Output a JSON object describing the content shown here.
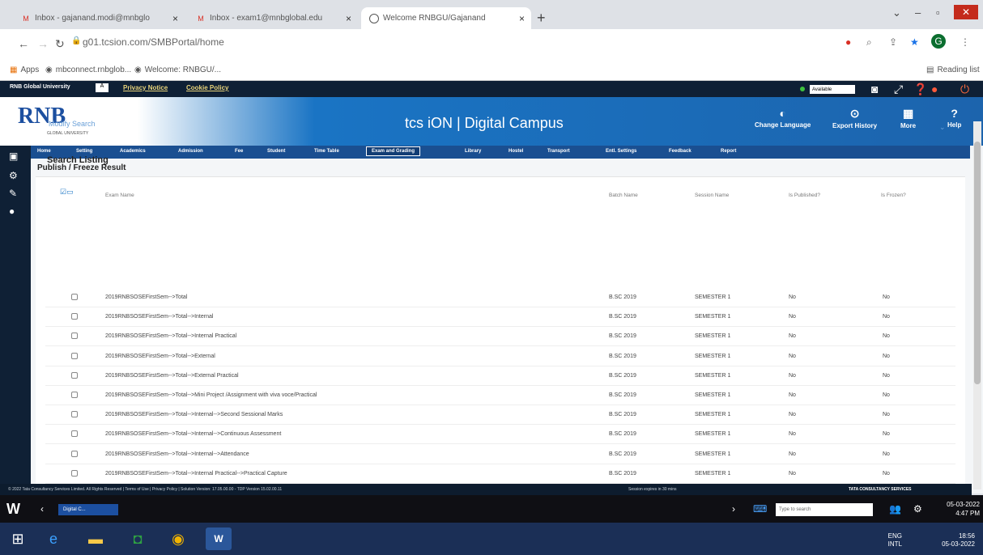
{
  "browser": {
    "tabs": [
      {
        "label": "Inbox - gajanand.modi@mnbglo",
        "close": "×"
      },
      {
        "label": "Inbox - exam1@mnbglobal.edu",
        "close": "×"
      },
      {
        "label": "Welcome RNBGU/Gajanand",
        "close": "×"
      }
    ],
    "new_tab": "+",
    "url": "g01.tcsion.com/SMBPortal/home",
    "bookmarks": [
      {
        "label": "Apps"
      },
      {
        "label": "mbconnect.rnbglob..."
      },
      {
        "label": "Welcome: RNBGU/..."
      }
    ],
    "reading_list": "Reading list",
    "profile_initial": "G"
  },
  "portal": {
    "university_label": "RNB Global University",
    "privacy": "Privacy Notice",
    "cookie": "Cookie Policy",
    "availability": "Available",
    "logo": "RNB",
    "logo_sub": "GLOBAL UNIVERSITY",
    "brand": "tcs iON | Digital Campus",
    "header_buttons": [
      "Change Language",
      "Export History",
      "More",
      "Help"
    ],
    "menu": [
      "Home",
      "Setting",
      "Academics",
      "Admission",
      "Fee",
      "Student",
      "Time Table",
      "Exam and Grading",
      "Library",
      "Hostel",
      "Transport",
      "Entl. Settings",
      "Feedback",
      "Report"
    ],
    "active_menu": "Exam and Grading",
    "breadcrumb": "Publish / Freeze Result",
    "modify_search": "Modify Search",
    "section_title": "Search Listing",
    "columns": {
      "exam": "Exam Name",
      "batch": "Batch Name",
      "session": "Session Name",
      "published": "Is Published?",
      "frozen": "Is Frozen?"
    },
    "rows": [
      {
        "exam": "2019RNBSOSEFirstSem-->Total",
        "batch": "B.SC 2019",
        "session": "SEMESTER 1",
        "published": "No",
        "frozen": "No"
      },
      {
        "exam": "2019RNBSOSEFirstSem-->Total-->Internal",
        "batch": "B.SC 2019",
        "session": "SEMESTER 1",
        "published": "No",
        "frozen": "No"
      },
      {
        "exam": "2019RNBSOSEFirstSem-->Total-->Internal Practical",
        "batch": "B.SC 2019",
        "session": "SEMESTER 1",
        "published": "No",
        "frozen": "No"
      },
      {
        "exam": "2019RNBSOSEFirstSem-->Total-->External",
        "batch": "B.SC 2019",
        "session": "SEMESTER 1",
        "published": "No",
        "frozen": "No"
      },
      {
        "exam": "2019RNBSOSEFirstSem-->Total-->External Practical",
        "batch": "B.SC 2019",
        "session": "SEMESTER 1",
        "published": "No",
        "frozen": "No"
      },
      {
        "exam": "2019RNBSOSEFirstSem-->Total-->Mini Project /Assignment with viva voce/Practical",
        "batch": "B.SC 2019",
        "session": "SEMESTER 1",
        "published": "No",
        "frozen": "No"
      },
      {
        "exam": "2019RNBSOSEFirstSem-->Total-->Internal-->Second Sessional Marks",
        "batch": "B.SC 2019",
        "session": "SEMESTER 1",
        "published": "No",
        "frozen": "No"
      },
      {
        "exam": "2019RNBSOSEFirstSem-->Total-->Internal-->Continuous Assessment",
        "batch": "B.SC 2019",
        "session": "SEMESTER 1",
        "published": "No",
        "frozen": "No"
      },
      {
        "exam": "2019RNBSOSEFirstSem-->Total-->Internal-->Attendance",
        "batch": "B.SC 2019",
        "session": "SEMESTER 1",
        "published": "No",
        "frozen": "No"
      },
      {
        "exam": "2019RNBSOSEFirstSem-->Total-->Internal Practical-->Practical Capture",
        "batch": "B.SC 2019",
        "session": "SEMESTER 1",
        "published": "No",
        "frozen": "No"
      }
    ],
    "footer_left": "© 2022 Tata Consultancy Services Limited. All Rights Reserved | Terms of Use | Privacy Policy | Solution Version: 17.05.00.00 - TDP Version 15.02.00.11",
    "footer_mid": "Session expires in 30 mins",
    "footer_right": "TATA CONSULTANCY SERVICES"
  },
  "remote_taskbar": {
    "tab": "Digital C...",
    "search": "Type to search",
    "date": "05-03-2022",
    "time": "4:47 PM"
  },
  "taskbar": {
    "lang": "ENG",
    "lang2": "INTL",
    "time": "18:56",
    "date": "05-03-2022"
  }
}
